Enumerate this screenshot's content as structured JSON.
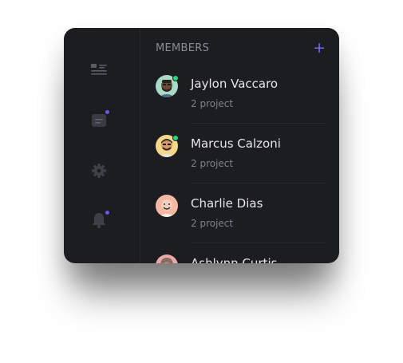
{
  "sidebar": {
    "items": [
      {
        "icon": "list-icon",
        "badge": false
      },
      {
        "icon": "chat-icon",
        "badge": true
      },
      {
        "icon": "gear-icon",
        "badge": false
      },
      {
        "icon": "bell-icon",
        "badge": true
      }
    ]
  },
  "members": {
    "title": "MEMBERS",
    "add_label": "+",
    "items": [
      {
        "name": "Jaylon Vaccaro",
        "subtitle": "2 project",
        "online": true,
        "avatar_color": "#a9d9c7"
      },
      {
        "name": "Marcus Calzoni",
        "subtitle": "2 project",
        "online": true,
        "avatar_color": "#f3d98a"
      },
      {
        "name": "Charlie Dias",
        "subtitle": "2 project",
        "online": false,
        "avatar_color": "#f4b8a3"
      },
      {
        "name": "Ashlynn Curtis",
        "subtitle": "",
        "online": false,
        "avatar_color": "#e9a9a9"
      }
    ]
  },
  "colors": {
    "panel": "#1c1d21",
    "accent": "#5b5cf0",
    "online": "#2bd67b"
  }
}
